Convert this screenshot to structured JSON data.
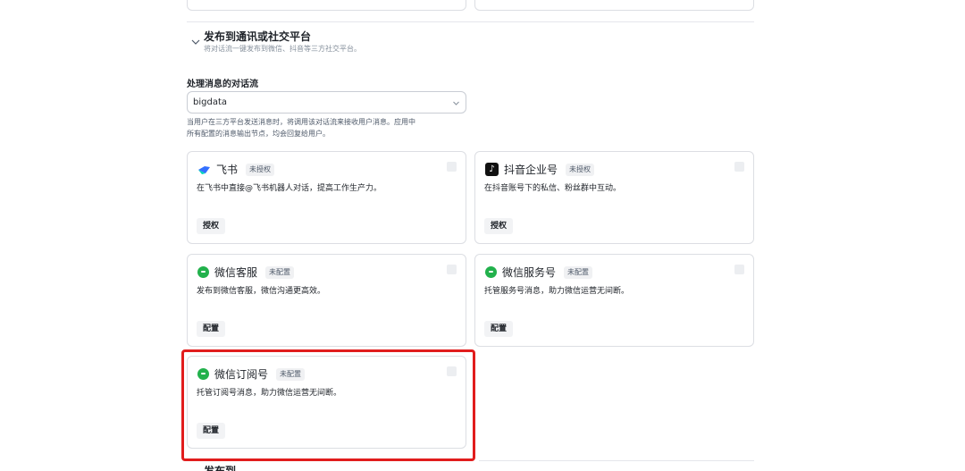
{
  "section": {
    "title": "发布到通讯或社交平台",
    "subtitle": "将对话流一键发布到微信、抖音等三方社交平台。"
  },
  "flow": {
    "label": "处理消息的对话流",
    "selected": "bigdata",
    "help_line1": "当用户在三方平台发送消息时，将调用该对话流来接收用户消息。应用中",
    "help_line2": "所有配置的消息输出节点，均会回复给用户。"
  },
  "cards": [
    {
      "title": "飞书",
      "badge": "未授权",
      "desc": "在飞书中直接@飞书机器人对话，提高工作生产力。",
      "button": "授权"
    },
    {
      "title": "抖音企业号",
      "badge": "未授权",
      "desc": "在抖音账号下的私信、粉丝群中互动。",
      "button": "授权"
    },
    {
      "title": "微信客服",
      "badge": "未配置",
      "desc": "发布到微信客服，微信沟通更高效。",
      "button": "配置"
    },
    {
      "title": "微信服务号",
      "badge": "未配置",
      "desc": "托管服务号消息，助力微信运营无间断。",
      "button": "配置"
    },
    {
      "title": "微信订阅号",
      "badge": "未配置",
      "desc": "托管订阅号消息，助力微信运营无间断。",
      "button": "配置"
    }
  ],
  "next_section_partial": "发布到...",
  "colors": {
    "highlight": "#e11d1d",
    "wechat": "#22b14c",
    "feishu": "#3370ff"
  }
}
